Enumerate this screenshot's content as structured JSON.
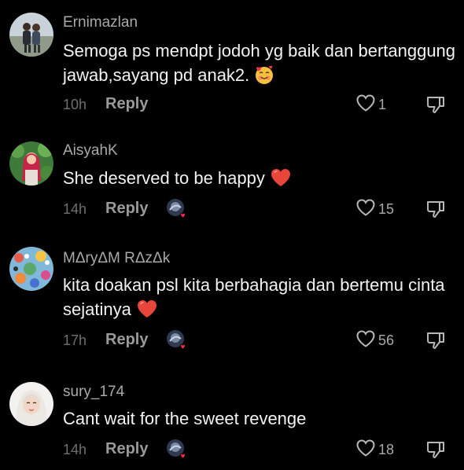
{
  "comments": [
    {
      "username": "Ernimazlan",
      "text": "Semoga ps mendpt jodoh yg baik dan bertanggung jawab,sayang pd anak2.",
      "emoji": "smiling-face-with-hearts",
      "time": "10h",
      "reply_label": "Reply",
      "likes": "1",
      "creator_liked": false
    },
    {
      "username": "AisyahK",
      "text": "She deserved to be happy",
      "emoji": "red-heart",
      "time": "14h",
      "reply_label": "Reply",
      "likes": "15",
      "creator_liked": true
    },
    {
      "username": "MΔryΔM RΔzΔk",
      "text": "kita doakan psl kita berbahagia dan bertemu cinta sejatinya",
      "emoji": "red-heart",
      "time": "17h",
      "reply_label": "Reply",
      "likes": "56",
      "creator_liked": true
    },
    {
      "username": "sury_174",
      "text": "Cant wait for the sweet revenge",
      "emoji": "",
      "time": "14h",
      "reply_label": "Reply",
      "likes": "18",
      "creator_liked": true
    }
  ],
  "colors": {
    "background": "#000000",
    "username": "#a9a9a9",
    "text": "#f2f2f2",
    "meta": "#6f6f6f",
    "heart_badge": "#fe2c55"
  }
}
